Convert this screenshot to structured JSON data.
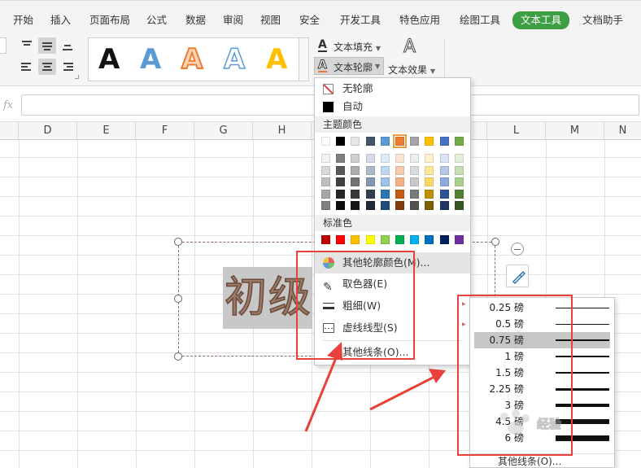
{
  "ribbon_tabs": [
    "开始",
    "插入",
    "页面布局",
    "公式",
    "数据",
    "审阅",
    "视图",
    "安全",
    "开发工具",
    "特色应用",
    "绘图工具",
    "文本工具",
    "文档助手"
  ],
  "ribbon": {
    "text_fill": "文本填充",
    "text_outline": "文本轮廓",
    "text_effects": "文本效果",
    "wordart_glyph": "A",
    "wordart_colors": [
      "#111111",
      "#5b9bd5",
      "#ed7d31",
      "#5b9bd5",
      "#ffc000"
    ]
  },
  "formula_bar": {
    "fx": "fx",
    "value": ""
  },
  "columns": [
    "D",
    "E",
    "F",
    "G",
    "H",
    "I",
    "J",
    "K",
    "L",
    "M",
    "N"
  ],
  "wordart_text": "初级",
  "outline_menu": {
    "no_outline": "无轮廓",
    "automatic": "自动",
    "theme_colors_header": "主题颜色",
    "theme_top": [
      "#ffffff",
      "#000000",
      "#e7e6e6",
      "#44546a",
      "#5b9bd5",
      "#ed7d31",
      "#a5a5a5",
      "#ffc000",
      "#4472c4",
      "#70ad47"
    ],
    "theme_shades": [
      [
        "#f2f2f2",
        "#7f7f7f",
        "#d0cece",
        "#d6dce5",
        "#deebf7",
        "#fbe5d6",
        "#ededed",
        "#fff2cc",
        "#dae3f3",
        "#e2f0d9"
      ],
      [
        "#d9d9d9",
        "#595959",
        "#aeabab",
        "#adb9ca",
        "#bdd7ee",
        "#f8cbad",
        "#dbdbdb",
        "#ffe699",
        "#b4c7e7",
        "#c5e0b4"
      ],
      [
        "#bfbfbf",
        "#404040",
        "#757171",
        "#8497b0",
        "#9dc3e6",
        "#f4b183",
        "#c9c9c9",
        "#ffd966",
        "#8faadc",
        "#a9d18e"
      ],
      [
        "#a6a6a6",
        "#262626",
        "#3a3838",
        "#333f50",
        "#2e75b6",
        "#c55a11",
        "#7b7b7b",
        "#bf9000",
        "#2f5597",
        "#548235"
      ],
      [
        "#808080",
        "#0d0d0d",
        "#171616",
        "#222a35",
        "#1f4e79",
        "#843c0c",
        "#525252",
        "#7f6000",
        "#203864",
        "#375623"
      ]
    ],
    "standard_colors_header": "标准色",
    "standard_colors": [
      "#c00000",
      "#ff0000",
      "#ffc000",
      "#ffff00",
      "#92d050",
      "#00b050",
      "#00b0f0",
      "#0070c0",
      "#002060",
      "#7030a0"
    ],
    "more_outline_colors": "其他轮廓颜色(M)...",
    "eyedropper": "取色器(E)",
    "weight": "粗细(W)",
    "dash_type": "虚线线型(S)",
    "more_lines": "其他线条(O)..."
  },
  "weight_submenu": {
    "items": [
      "0.25 磅",
      "0.5 磅",
      "0.75 磅",
      "1 磅",
      "1.5 磅",
      "2.25 磅",
      "3 磅",
      "4.5 磅",
      "6 磅"
    ],
    "selected_index": 2,
    "more_lines": "其他线条(O)..."
  },
  "watermark": "经验"
}
